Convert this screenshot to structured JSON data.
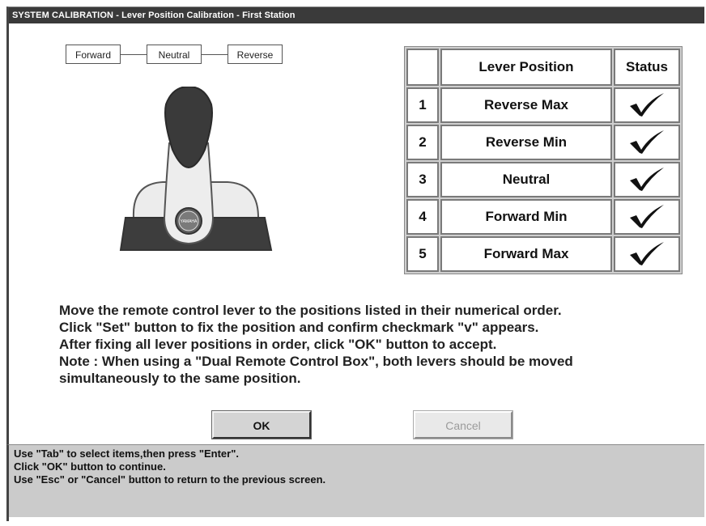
{
  "window": {
    "title": "SYSTEM CALIBRATION - Lever Position Calibration - First Station"
  },
  "positions_diagram": {
    "labels": [
      "Forward",
      "Neutral",
      "Reverse"
    ]
  },
  "lever_image": {
    "knob_text": "YAMAHA"
  },
  "table": {
    "headers": {
      "num": "",
      "position": "Lever Position",
      "status": "Status"
    },
    "rows": [
      {
        "num": "1",
        "position": "Reverse Max",
        "status": "check-icon"
      },
      {
        "num": "2",
        "position": "Reverse Min",
        "status": "check-icon"
      },
      {
        "num": "3",
        "position": "Neutral",
        "status": "check-icon"
      },
      {
        "num": "4",
        "position": "Forward Min",
        "status": "check-icon"
      },
      {
        "num": "5",
        "position": "Forward Max",
        "status": "check-icon"
      }
    ]
  },
  "instructions": [
    "Move the remote control lever to the positions listed in their numerical order.",
    "Click \"Set\" button to fix the position and confirm checkmark \"v\" appears.",
    "After fixing all lever positions in order, click \"OK\" button to accept.",
    "Note : When using a \"Dual Remote Control Box\", both levers should be moved",
    "simultaneously to the same position."
  ],
  "buttons": {
    "ok": "OK",
    "cancel": "Cancel"
  },
  "status_bar": [
    "Use \"Tab\" to select items,then press \"Enter\".",
    "Click \"OK\" button to continue.",
    "Use \"Esc\" or \"Cancel\" button to return to the previous screen."
  ],
  "colors": {
    "title_bar": "#3a3a3a",
    "status_bar": "#cbcbcb",
    "lever_dark": "#3d3d3d",
    "lever_light": "#ececec"
  }
}
